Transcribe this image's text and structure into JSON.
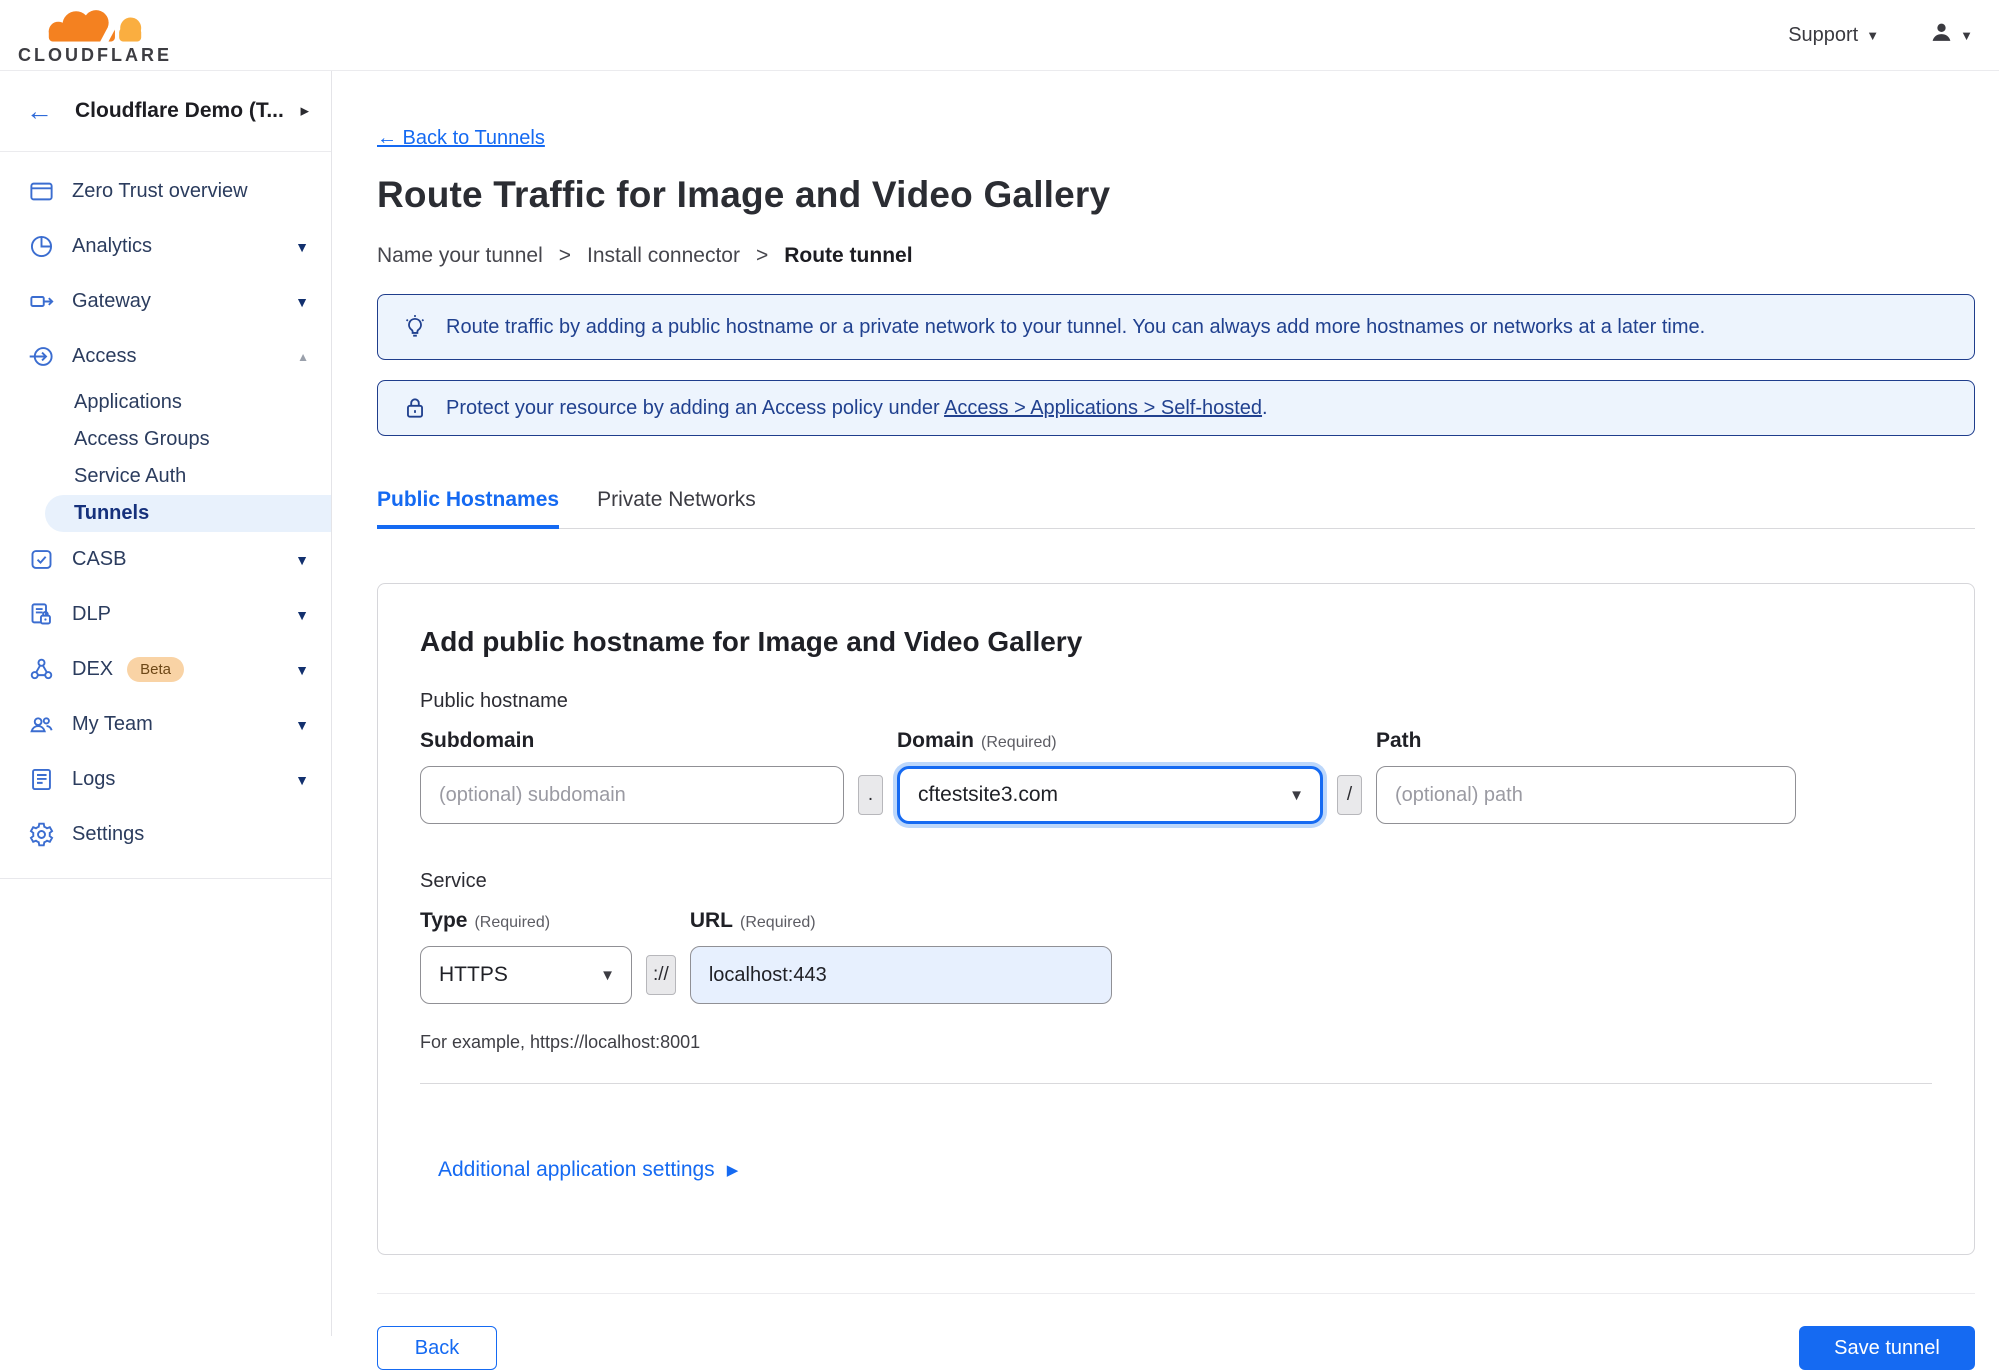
{
  "header": {
    "logo_text": "CLOUDFLARE",
    "support_label": "Support"
  },
  "icons": {
    "chevron_down": "▼",
    "chevron_up": "▲",
    "chevron_right": "›",
    "dropdown_caret": "▼",
    "expand_right": "▶"
  },
  "sidebar": {
    "account_name": "Cloudflare Demo (T...",
    "items": [
      {
        "label": "Zero Trust overview"
      },
      {
        "label": "Analytics"
      },
      {
        "label": "Gateway"
      },
      {
        "label": "Access"
      },
      {
        "label": "Applications"
      },
      {
        "label": "Access Groups"
      },
      {
        "label": "Service Auth"
      },
      {
        "label": "Tunnels"
      },
      {
        "label": "CASB"
      },
      {
        "label": "DLP"
      },
      {
        "label": "DEX",
        "badge": "Beta"
      },
      {
        "label": "My Team"
      },
      {
        "label": "Logs"
      },
      {
        "label": "Settings"
      }
    ]
  },
  "main": {
    "back_link": "← Back to Tunnels",
    "title": "Route Traffic for Image and Video Gallery",
    "breadcrumb": {
      "separator": ">",
      "steps": [
        "Name your tunnel",
        "Install connector",
        "Route tunnel"
      ]
    },
    "banners": {
      "tip": "Route traffic by adding a public hostname or a private network to your tunnel. You can always add more hostnames or networks at a later time.",
      "access_prefix": "Protect your resource by adding an Access policy under",
      "access_link": "Access > Applications > Self-hosted",
      "access_suffix": "."
    },
    "tabs": [
      {
        "label": "Public Hostnames"
      },
      {
        "label": "Private Networks"
      }
    ],
    "form": {
      "heading": "Add public hostname for Image and Video Gallery",
      "public_hostname_label": "Public hostname",
      "subdomain": {
        "label": "Subdomain",
        "placeholder": "(optional) subdomain"
      },
      "dot_separator": ".",
      "domain": {
        "label": "Domain",
        "required": "(Required)",
        "value": "cftestsite3.com"
      },
      "slash_separator": "/",
      "path": {
        "label": "Path",
        "placeholder": "(optional) path"
      },
      "service_label": "Service",
      "type": {
        "label": "Type",
        "required": "(Required)",
        "value": "HTTPS"
      },
      "scheme_separator": "://",
      "url": {
        "label": "URL",
        "required": "(Required)",
        "value": "localhost:443"
      },
      "example_hint": "For example, https://localhost:8001",
      "additional_settings": "Additional application settings"
    },
    "footer": {
      "back_label": "Back",
      "save_label": "Save tunnel"
    }
  },
  "colors": {
    "accent_blue": "#156af2",
    "banner_navy": "#21418f",
    "brand_orange": "#f48120",
    "brand_orange_light": "#faae40",
    "active_pill_bg": "#e8f1fc",
    "url_autofill_bg": "#e7f0fe"
  }
}
